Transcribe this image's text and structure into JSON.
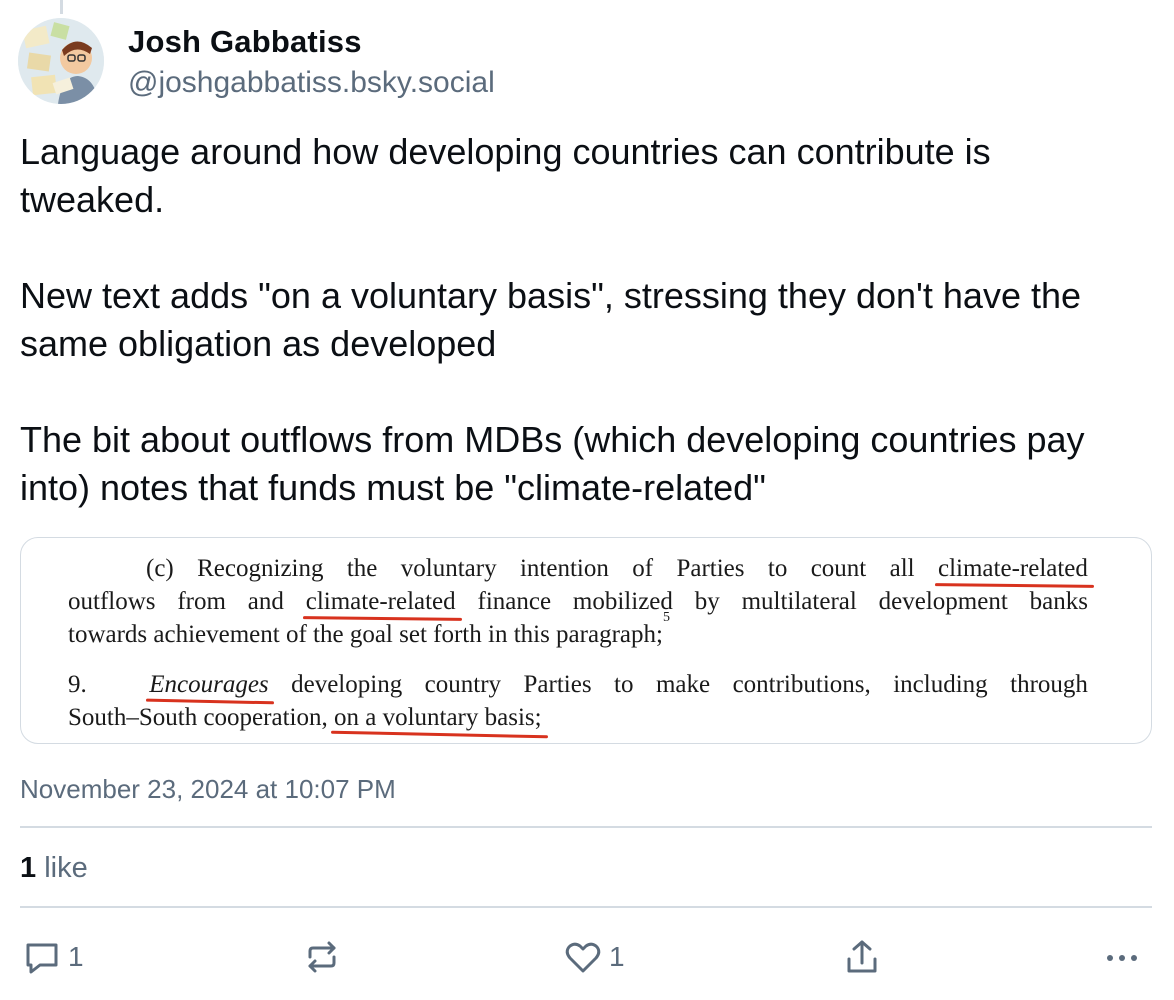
{
  "post": {
    "author": {
      "display_name": "Josh Gabbatiss",
      "handle": "@joshgabbatiss.bsky.social"
    },
    "text_paragraphs": [
      "Language around how developing countries can contribute is tweaked.",
      "New text adds \"on a voluntary basis\", stressing they don't have the same obligation as developed",
      "The bit about outflows from MDBs (which developing countries pay into) notes that funds must be \"climate-related\""
    ],
    "embedded_document": {
      "para_c_marker": "(c)",
      "para_c_line1_words": [
        "Recognizing",
        "the",
        "voluntary",
        "intention",
        "of",
        "Parties",
        "to",
        "count",
        "all"
      ],
      "para_c_line1_underlined": "climate-related",
      "para_c_line2_start": "outflows",
      "para_c_line2_mid1": "from",
      "para_c_line2_mid2": "and",
      "para_c_line2_underlined": "climate-related",
      "para_c_line2_rest_words": [
        "finance",
        "mobilized",
        "by",
        "multilateral",
        "development",
        "banks"
      ],
      "para_c_line3": "towards achievement of the goal set forth in this paragraph;",
      "para_c_footnote": "5",
      "para_9_number": "9.",
      "para_9_underlined_italic": "Encourages",
      "para_9_line1_words": [
        "developing",
        "country",
        "Parties",
        "to",
        "make",
        "contributions,",
        "including",
        "through"
      ],
      "para_9_line2_start": "South–South cooperation,",
      "para_9_line2_underlined": "on a voluntary basis;"
    },
    "timestamp": "November 23, 2024 at 10:07 PM",
    "like_count": "1",
    "like_label": "like",
    "actions": {
      "reply_count": "1",
      "like_count": "1"
    },
    "colors": {
      "underline_annotation": "#d8321e",
      "muted_text": "#5b6b7c",
      "divider": "#d4dbe2"
    }
  }
}
